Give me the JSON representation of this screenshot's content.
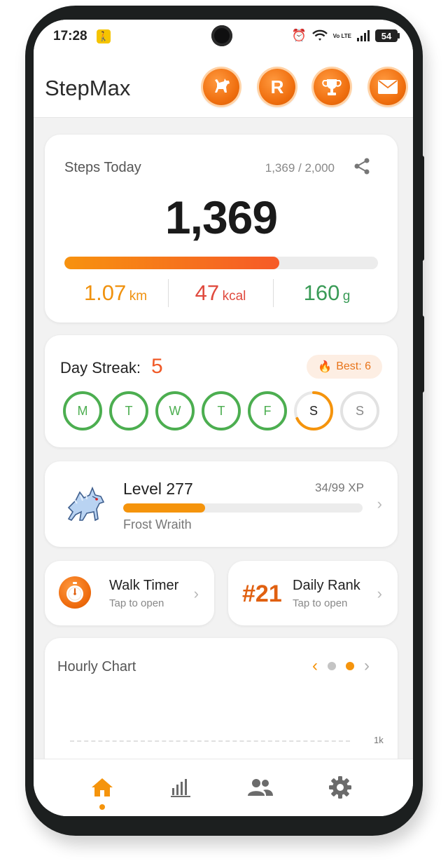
{
  "status_bar": {
    "time": "17:28",
    "network": "Vo LTE",
    "battery": "54"
  },
  "header": {
    "title": "StepMax",
    "buttons": [
      {
        "label": "",
        "icon": "dog-icon"
      },
      {
        "label": "R",
        "icon": "r-badge-icon"
      },
      {
        "label": "",
        "icon": "trophy-icon"
      },
      {
        "label": "",
        "icon": "mail-icon"
      }
    ]
  },
  "steps": {
    "label": "Steps Today",
    "ratio": "1,369 / 2,000",
    "count": "1,369",
    "progress": 0.6845,
    "distance_value": "1.07",
    "distance_unit": "km",
    "calories_value": "47",
    "calories_unit": "kcal",
    "weight_value": "160",
    "weight_unit": "g",
    "colors": {
      "distance": "#f0920f",
      "calories": "#e04a3e",
      "weight": "#3a9b57"
    }
  },
  "streak": {
    "label": "Day Streak:",
    "value": "5",
    "best": "Best: 6",
    "days": [
      {
        "letter": "M",
        "state": "done"
      },
      {
        "letter": "T",
        "state": "done"
      },
      {
        "letter": "W",
        "state": "done"
      },
      {
        "letter": "T",
        "state": "done"
      },
      {
        "letter": "F",
        "state": "done"
      },
      {
        "letter": "S",
        "state": "today",
        "progress": 0.68
      },
      {
        "letter": "S",
        "state": "empty"
      }
    ]
  },
  "level": {
    "title": "Level 277",
    "xp": "34/99 XP",
    "progress": 0.343,
    "creature": "Frost Wraith"
  },
  "walk_timer": {
    "title": "Walk Timer",
    "subtitle": "Tap to open"
  },
  "daily_rank": {
    "rank": "#21",
    "title": "Daily Rank",
    "subtitle": "Tap to open"
  },
  "hourly_chart": {
    "title": "Hourly Chart",
    "tick": "1k",
    "page_active": 1,
    "page_count": 2
  },
  "bottom_nav": {
    "items": [
      "home-icon",
      "stats-icon",
      "friends-icon",
      "settings-icon"
    ],
    "active": 0
  },
  "accent": "#f5940c"
}
